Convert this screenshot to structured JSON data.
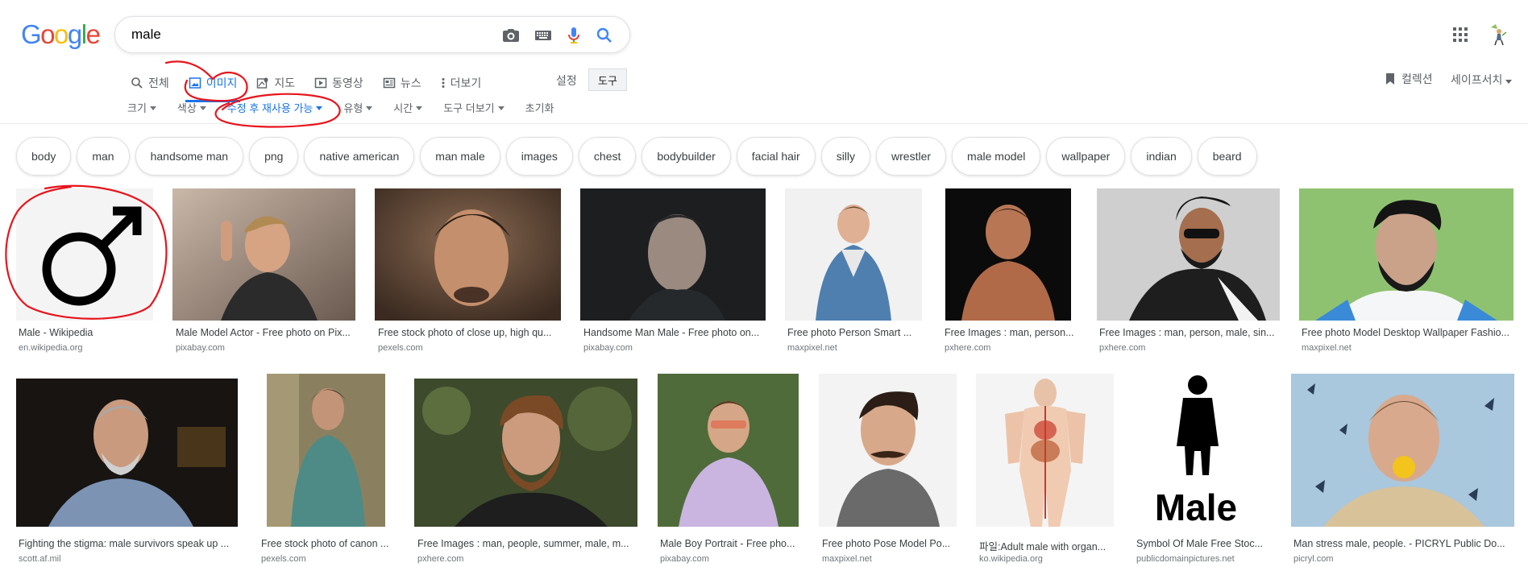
{
  "logo": {
    "letters": [
      "G",
      "o",
      "o",
      "g",
      "l",
      "e"
    ],
    "colors": [
      "#4285F4",
      "#EA4335",
      "#FBBC05",
      "#4285F4",
      "#34A853",
      "#EA4335"
    ]
  },
  "search": {
    "query": "male"
  },
  "tabs": [
    {
      "label": "전체",
      "icon": "search-icon",
      "active": false
    },
    {
      "label": "이미지",
      "icon": "image-icon",
      "active": true
    },
    {
      "label": "지도",
      "icon": "map-icon",
      "active": false
    },
    {
      "label": "동영상",
      "icon": "video-icon",
      "active": false
    },
    {
      "label": "뉴스",
      "icon": "news-icon",
      "active": false
    },
    {
      "label": "더보기",
      "icon": "more-vert-icon",
      "active": false
    }
  ],
  "header_right": {
    "settings": "설정",
    "tools": "도구",
    "collections": "컬렉션",
    "safesearch": "세이프서치"
  },
  "tools": [
    {
      "label": "크기",
      "caret": true,
      "active": false
    },
    {
      "label": "색상",
      "caret": true,
      "active": false
    },
    {
      "label": "수정 후 재사용 가능",
      "caret": true,
      "active": true
    },
    {
      "label": "유형",
      "caret": true,
      "active": false
    },
    {
      "label": "시간",
      "caret": true,
      "active": false
    },
    {
      "label": "도구 더보기",
      "caret": true,
      "active": false
    },
    {
      "label": "초기화",
      "caret": false,
      "active": false
    }
  ],
  "chips": [
    "body",
    "man",
    "handsome man",
    "png",
    "native american",
    "man male",
    "images",
    "chest",
    "bodybuilder",
    "facial hair",
    "silly",
    "wrestler",
    "male model",
    "wallpaper",
    "indian",
    "beard"
  ],
  "results_row1": [
    {
      "caption": "Male - Wikipedia",
      "source": "en.wikipedia.org"
    },
    {
      "caption": "Male Model Actor - Free photo on Pix...",
      "source": "pixabay.com"
    },
    {
      "caption": "Free stock photo of close up, high qu...",
      "source": "pexels.com"
    },
    {
      "caption": "Handsome Man Male - Free photo on...",
      "source": "pixabay.com"
    },
    {
      "caption": "Free photo Person Smart ...",
      "source": "maxpixel.net"
    },
    {
      "caption": "Free Images : man, person...",
      "source": "pxhere.com"
    },
    {
      "caption": "Free Images : man, person, male, sin...",
      "source": "pxhere.com"
    },
    {
      "caption": "Free photo Model Desktop Wallpaper Fashio...",
      "source": "maxpixel.net"
    }
  ],
  "results_row2": [
    {
      "caption": "Fighting the stigma: male survivors speak up ...",
      "source": "scott.af.mil"
    },
    {
      "caption": "Free stock photo of canon ...",
      "source": "pexels.com"
    },
    {
      "caption": "Free Images : man, people, summer, male, m...",
      "source": "pxhere.com"
    },
    {
      "caption": "Male Boy Portrait - Free pho...",
      "source": "pixabay.com"
    },
    {
      "caption": "Free photo Pose Model Po...",
      "source": "maxpixel.net"
    },
    {
      "caption": "파일:Adult male with organ...",
      "source": "ko.wikipedia.org"
    },
    {
      "caption": "Symbol Of Male Free Stoc...",
      "source": "publicdomainpictures.net"
    },
    {
      "caption": "Man stress male, people. - PICRYL Public Do...",
      "source": "picryl.com"
    }
  ],
  "male_sign_text": "Male",
  "accent": "#1a73e8",
  "annotation_color": "#e8141c"
}
